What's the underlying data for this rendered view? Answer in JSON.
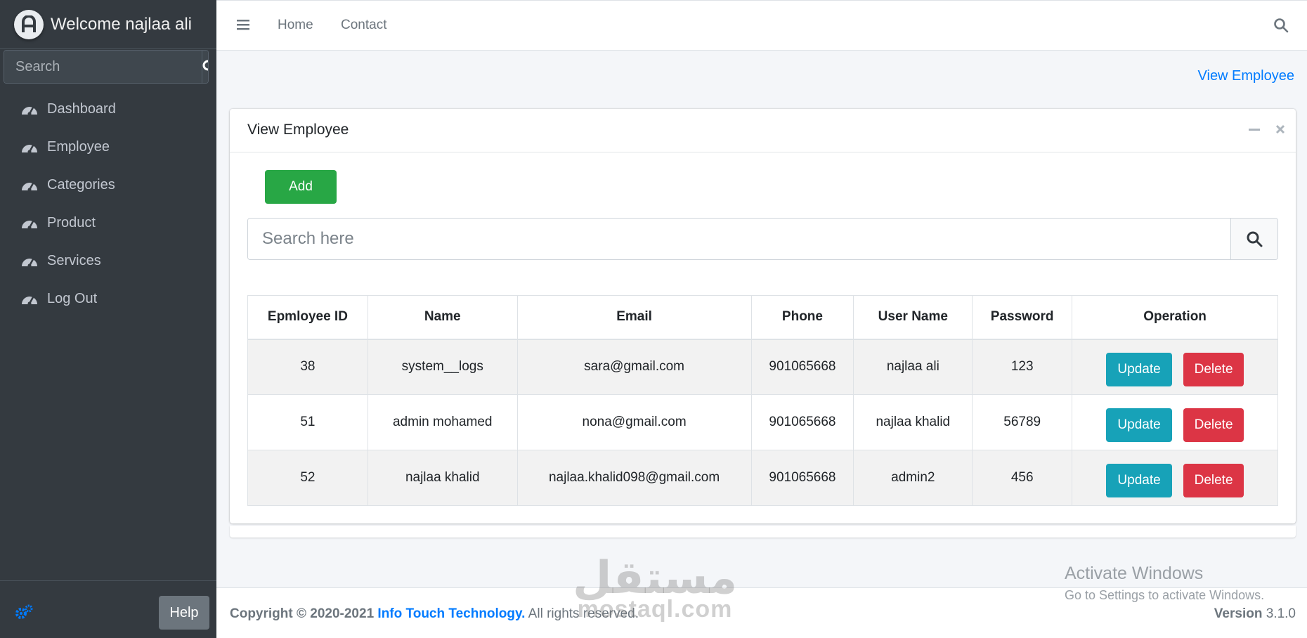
{
  "sidebar": {
    "brand": "Welcome najlaa ali",
    "search_placeholder": "Search",
    "items": [
      {
        "label": "Dashboard"
      },
      {
        "label": "Employee"
      },
      {
        "label": "Categories"
      },
      {
        "label": "Product"
      },
      {
        "label": "Services"
      },
      {
        "label": "Log Out"
      }
    ],
    "help_label": "Help"
  },
  "topbar": {
    "home": "Home",
    "contact": "Contact"
  },
  "breadcrumb": "View Employee",
  "card": {
    "title": "View Employee",
    "add_label": "Add",
    "search_placeholder": "Search here"
  },
  "table": {
    "headers": [
      "Epmloyee ID",
      "Name",
      "Email",
      "Phone",
      "User Name",
      "Password",
      "Operation"
    ],
    "rows": [
      {
        "id": "38",
        "name": "system__logs",
        "email": "sara@gmail.com",
        "phone": "901065668",
        "username": "najlaa ali",
        "password": "123"
      },
      {
        "id": "51",
        "name": "admin mohamed",
        "email": "nona@gmail.com",
        "phone": "901065668",
        "username": "najlaa khalid",
        "password": "56789"
      },
      {
        "id": "52",
        "name": "najlaa khalid",
        "email": "najlaa.khalid098@gmail.com",
        "phone": "901065668",
        "username": "admin2",
        "password": "456"
      }
    ],
    "update_label": "Update",
    "delete_label": "Delete"
  },
  "footer": {
    "copyright": "Copyright © 2020-2021",
    "company": "Info Touch Technology.",
    "rights": " All rights reserved.",
    "version_label": "Version",
    "version": " 3.1.0"
  },
  "watermark": {
    "activate": "Activate Windows",
    "goto": "Go to Settings to activate Windows.",
    "mostaql_ar": "مستقل",
    "mostaql_en": "mostaql.com"
  },
  "colors": {
    "sidebar": "#343a40",
    "primary": "#007bff",
    "success": "#28a745",
    "info": "#17a2b8",
    "danger": "#dc3545"
  }
}
